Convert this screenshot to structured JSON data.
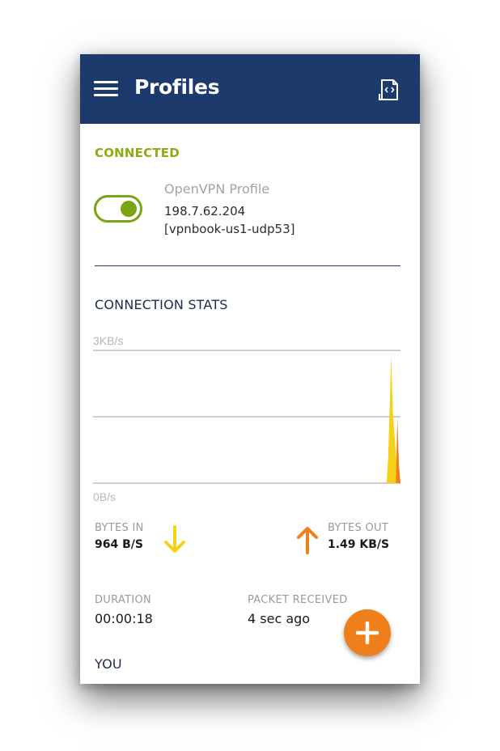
{
  "appbar": {
    "title": "Profiles",
    "menu_icon": "hamburger-menu-icon",
    "action_icon": "file-code-import-icon"
  },
  "status": {
    "label": "CONNECTED",
    "toggle_state": "on"
  },
  "profile": {
    "name": "OpenVPN Profile",
    "ip": "198.7.62.204",
    "server": "[vpnbook-us1-udp53]"
  },
  "stats": {
    "title": "CONNECTION STATS",
    "chart_max_label": "3KB/s",
    "chart_min_label": "0B/s",
    "bytes_in_label": "BYTES IN",
    "bytes_in_value": "964 B/S",
    "bytes_out_label": "BYTES OUT",
    "bytes_out_value": "1.49 KB/S",
    "duration_label": "DURATION",
    "duration_value": "00:00:18",
    "packet_label": "PACKET RECEIVED",
    "packet_value": "4 sec ago"
  },
  "you_label": "YOU",
  "chart_data": {
    "type": "area",
    "y_range": [
      0,
      3
    ],
    "y_unit": "KB/s",
    "series": [
      {
        "color": "#f7d117",
        "points": [
          [
            0,
            0
          ],
          [
            0.955,
            0
          ],
          [
            0.96,
            0.6
          ],
          [
            0.97,
            2.9
          ],
          [
            0.975,
            1.6
          ],
          [
            0.99,
            0.2
          ],
          [
            1,
            0
          ]
        ]
      },
      {
        "color": "#ee7f1b",
        "points": [
          [
            0,
            0
          ],
          [
            0.985,
            0
          ],
          [
            0.99,
            1.5
          ],
          [
            0.995,
            0.4
          ],
          [
            1,
            0
          ]
        ]
      }
    ]
  },
  "colors": {
    "appbar": "#1c3a6b",
    "connected": "#8bad13",
    "bytes_in_arrow": "#f7d117",
    "bytes_out_arrow": "#ee7f1b",
    "fab": "#ee7f1b"
  },
  "fab": {
    "icon": "plus-icon"
  }
}
